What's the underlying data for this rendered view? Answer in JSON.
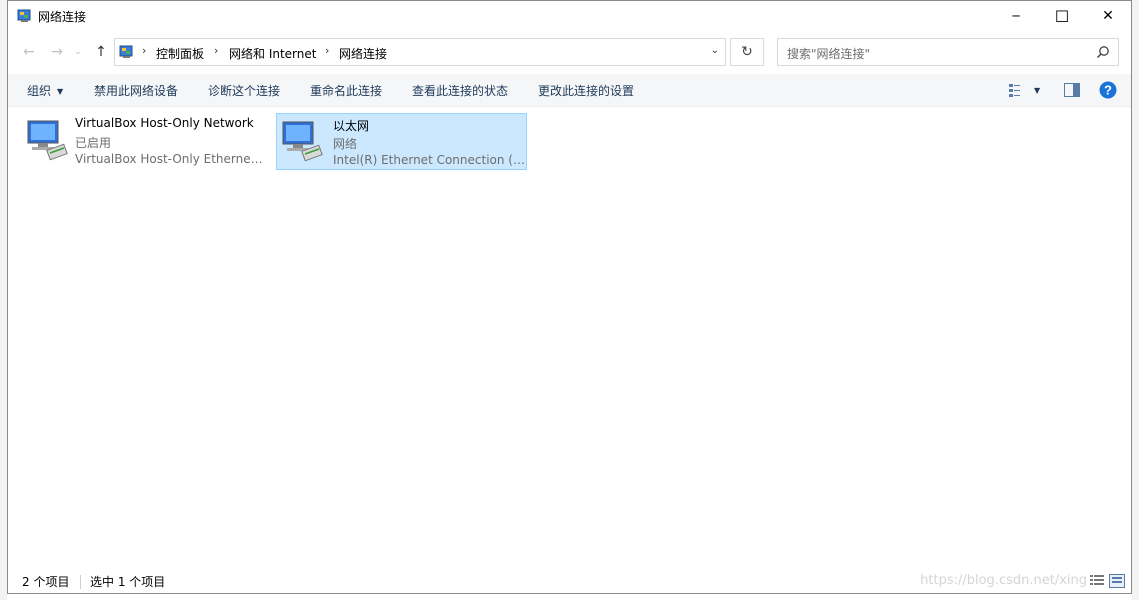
{
  "window": {
    "title": "网络连接",
    "minimize_glyph": "─",
    "maximize_glyph": "☐",
    "close_glyph": "✕"
  },
  "address": {
    "breadcrumbs": [
      "控制面板",
      "网络和 Internet",
      "网络连接"
    ],
    "separator": "›",
    "dropdown_glyph": "⌄",
    "refresh_glyph": "↻"
  },
  "search": {
    "placeholder": "搜索\"网络连接\""
  },
  "toolbar": {
    "organize": "组织",
    "disable_device": "禁用此网络设备",
    "diagnose": "诊断这个连接",
    "rename": "重命名此连接",
    "view_status": "查看此连接的状态",
    "change_settings": "更改此连接的设置"
  },
  "items": [
    {
      "name": "VirtualBox Host-Only Network",
      "status": "已启用",
      "adapter": "VirtualBox Host-Only Ethernet ..."
    },
    {
      "name": "以太网",
      "status": "网络",
      "adapter": "Intel(R) Ethernet Connection (2..."
    }
  ],
  "statusbar": {
    "count": "2 个项目",
    "selected": "选中 1 个项目",
    "watermark": "https://blog.csdn.net/xing"
  },
  "colors": {
    "selection_bg": "#cce8ff",
    "selection_border": "#99d1ff",
    "toolbar_text": "#1e395b",
    "help_blue": "#1a73d9"
  }
}
